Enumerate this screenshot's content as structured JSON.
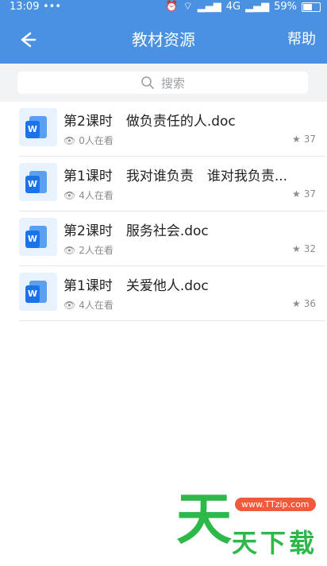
{
  "status_bar": {
    "time": "13:09",
    "dots": "•••",
    "network": "4G",
    "battery": "59%"
  },
  "nav": {
    "title": "教材资源",
    "help": "帮助"
  },
  "search": {
    "placeholder": "搜索"
  },
  "items": [
    {
      "name": "第2课时　做负责任的人.doc",
      "viewers": "0人在看",
      "stars": "37"
    },
    {
      "name": "第1课时　我对谁负责　谁对我负责...",
      "viewers": "4人在看",
      "stars": "37"
    },
    {
      "name": "第2课时　服务社会.doc",
      "viewers": "2人在看",
      "stars": "32"
    },
    {
      "name": "第1课时　关爱他人.doc",
      "viewers": "4人在看",
      "stars": "36"
    }
  ],
  "watermark": {
    "big": "天",
    "url": "www.TTzip.com",
    "text": "天下载"
  },
  "colors": {
    "header": "#4a91e2",
    "icon_blue": "#1a73e8",
    "watermark_green": "#2fb84a"
  }
}
